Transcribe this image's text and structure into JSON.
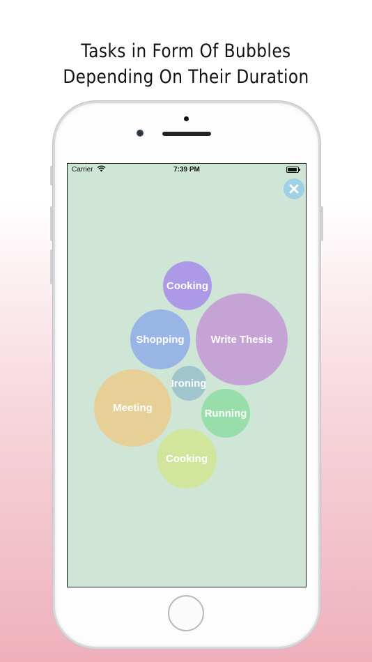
{
  "headline": {
    "line1": "Tasks in Form Of Bubbles",
    "line2": "Depending On Their Duration"
  },
  "status_bar": {
    "carrier": "Carrier",
    "time": "7:39 PM"
  },
  "icons": {
    "wifi": "wifi-icon",
    "battery": "battery-icon",
    "close": "close-icon"
  },
  "colors": {
    "screen_background": "#cfe6d7",
    "close_button": "#9fd0e6"
  },
  "bubbles": [
    {
      "label": "Cooking",
      "color": "#ad9ae6"
    },
    {
      "label": "Shopping",
      "color": "#98b5e6"
    },
    {
      "label": "Write Thesis",
      "color": "#c5a3d4"
    },
    {
      "label": "Ironing",
      "color": "#a0c5cd"
    },
    {
      "label": "Meeting",
      "color": "#e6d097"
    },
    {
      "label": "Running",
      "color": "#98deaa"
    },
    {
      "label": "Cooking",
      "color": "#d1e59d"
    }
  ]
}
